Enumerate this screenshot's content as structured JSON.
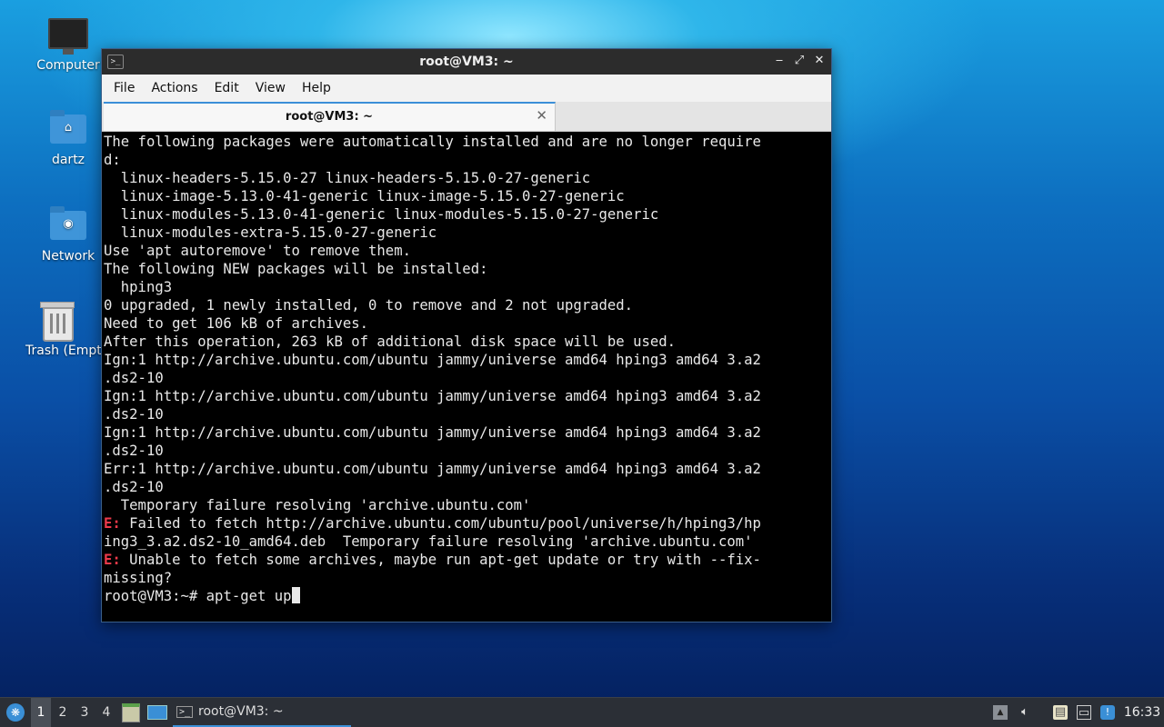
{
  "desktop": {
    "icons": [
      {
        "label": "Computer"
      },
      {
        "label": "dartz"
      },
      {
        "label": "Network"
      },
      {
        "label": "Trash (Empty)"
      }
    ]
  },
  "window": {
    "title": "root@VM3: ~",
    "menu": [
      "File",
      "Actions",
      "Edit",
      "View",
      "Help"
    ],
    "tab_title": "root@VM3: ~"
  },
  "terminal": {
    "lines": [
      {
        "text": "The following packages were automatically installed and are no longer require"
      },
      {
        "text": "d:"
      },
      {
        "text": "  linux-headers-5.15.0-27 linux-headers-5.15.0-27-generic"
      },
      {
        "text": "  linux-image-5.13.0-41-generic linux-image-5.15.0-27-generic"
      },
      {
        "text": "  linux-modules-5.13.0-41-generic linux-modules-5.15.0-27-generic"
      },
      {
        "text": "  linux-modules-extra-5.15.0-27-generic"
      },
      {
        "text": "Use 'apt autoremove' to remove them."
      },
      {
        "text": "The following NEW packages will be installed:"
      },
      {
        "text": "  hping3"
      },
      {
        "text": "0 upgraded, 1 newly installed, 0 to remove and 2 not upgraded."
      },
      {
        "text": "Need to get 106 kB of archives."
      },
      {
        "text": "After this operation, 263 kB of additional disk space will be used."
      },
      {
        "text": "Ign:1 http://archive.ubuntu.com/ubuntu jammy/universe amd64 hping3 amd64 3.a2"
      },
      {
        "text": ".ds2-10"
      },
      {
        "text": "Ign:1 http://archive.ubuntu.com/ubuntu jammy/universe amd64 hping3 amd64 3.a2"
      },
      {
        "text": ".ds2-10"
      },
      {
        "text": "Ign:1 http://archive.ubuntu.com/ubuntu jammy/universe amd64 hping3 amd64 3.a2"
      },
      {
        "text": ".ds2-10"
      },
      {
        "text": "Err:1 http://archive.ubuntu.com/ubuntu jammy/universe amd64 hping3 amd64 3.a2"
      },
      {
        "text": ".ds2-10"
      },
      {
        "text": "  Temporary failure resolving 'archive.ubuntu.com'"
      },
      {
        "prefix": "E:",
        "text": " Failed to fetch http://archive.ubuntu.com/ubuntu/pool/universe/h/hping3/hp"
      },
      {
        "text": "ing3_3.a2.ds2-10_amd64.deb  Temporary failure resolving 'archive.ubuntu.com'"
      },
      {
        "prefix": "E:",
        "text": " Unable to fetch some archives, maybe run apt-get update or try with --fix-"
      },
      {
        "text": "missing?"
      }
    ],
    "prompt": "root@VM3:~# ",
    "input": "apt-get up"
  },
  "taskbar": {
    "workspaces": [
      "1",
      "2",
      "3",
      "4"
    ],
    "active_workspace": "1",
    "task_label": "root@VM3: ~",
    "clock": "16:33"
  },
  "colors": {
    "error_prefix": "#ef3a4a",
    "tab_accent": "#3b8fd8"
  }
}
